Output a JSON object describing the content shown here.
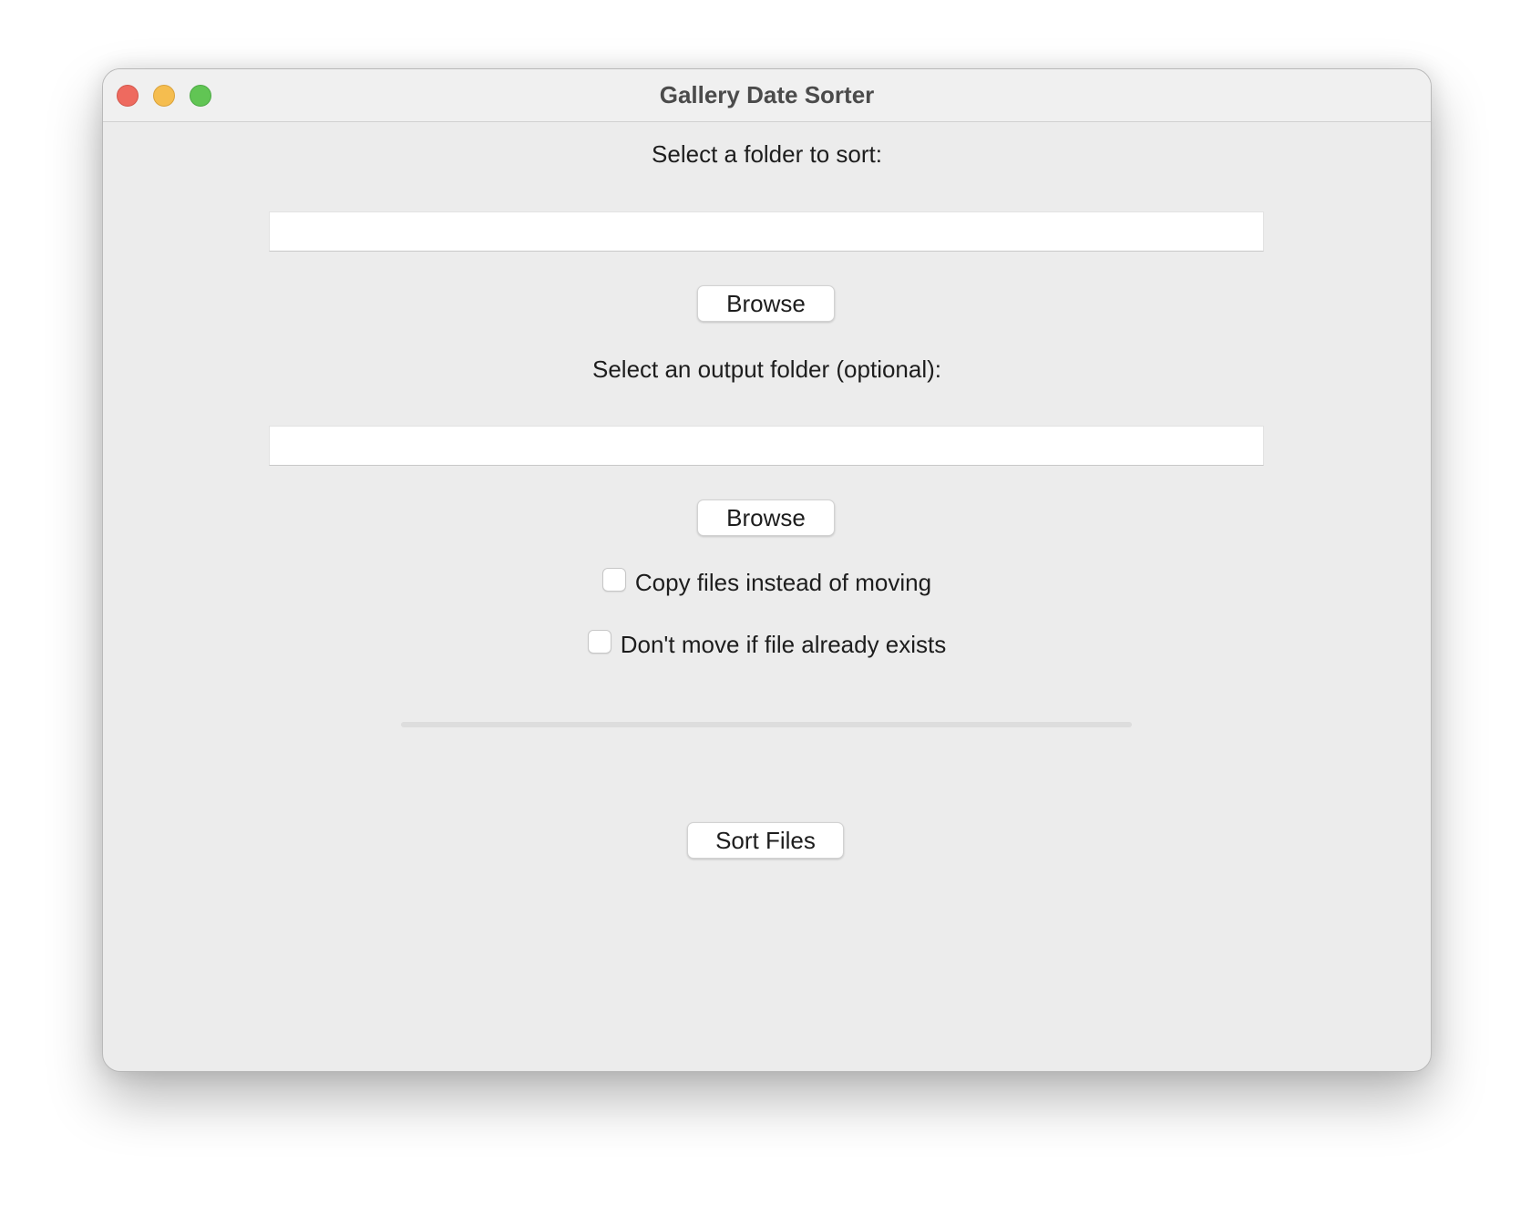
{
  "window": {
    "title": "Gallery Date Sorter"
  },
  "source": {
    "label": "Select a folder to sort:",
    "value": "",
    "browse_label": "Browse"
  },
  "output": {
    "label": "Select an output folder (optional):",
    "value": "",
    "browse_label": "Browse"
  },
  "options": {
    "copy": {
      "label": "Copy files instead of moving",
      "checked": false
    },
    "skip_existing": {
      "label": "Don't move if file already exists",
      "checked": false
    }
  },
  "progress": {
    "value": 0
  },
  "actions": {
    "sort_label": "Sort Files"
  }
}
